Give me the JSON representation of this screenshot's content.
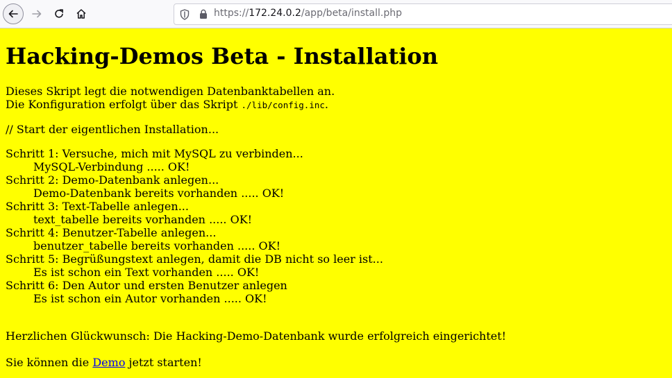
{
  "browser": {
    "url_prefix": "https://",
    "url_host": "172.24.0.2",
    "url_path": "/app/beta/install.php"
  },
  "page": {
    "title": "Hacking-Demos Beta - Installation",
    "intro_line1": "Dieses Skript legt die notwendigen Datenbanktabellen an.",
    "intro_line2_prefix": "Die Konfiguration erfolgt über das Skript ",
    "config_path": "./lib/config.inc",
    "intro_line2_suffix": ".",
    "start_comment": "// Start der eigentlichen Installation...",
    "steps": [
      {
        "label": "Schritt 1: Versuche, mich mit MySQL zu verbinden...",
        "result": "MySQL-Verbindung ..... OK!"
      },
      {
        "label": "Schritt 2: Demo-Datenbank anlegen...",
        "result": "Demo-Datenbank bereits vorhanden ..... OK!"
      },
      {
        "label": "Schritt 3: Text-Tabelle anlegen...",
        "result": "text_tabelle bereits vorhanden ..... OK!"
      },
      {
        "label": "Schritt 4: Benutzer-Tabelle anlegen...",
        "result": "benutzer_tabelle bereits vorhanden ..... OK!"
      },
      {
        "label": "Schritt 5: Begrüßungstext anlegen, damit die DB nicht so leer ist...",
        "result": "Es ist schon ein Text vorhanden ..... OK!"
      },
      {
        "label": "Schritt 6: Den Autor und ersten Benutzer anlegen",
        "result": "Es ist schon ein Autor vorhanden ..... OK!"
      }
    ],
    "congrats": "Herzlichen Glückwunsch: Die Hacking-Demo-Datenbank wurde erfolgreich eingerichtet!",
    "start_prefix": "Sie können die ",
    "demo_link": "Demo",
    "start_suffix": " jetzt starten!"
  },
  "colors": {
    "page_background": "#ffff00",
    "link": "#0000ee"
  },
  "icons": {
    "back": "arrow-left-icon",
    "forward": "arrow-right-icon",
    "reload": "reload-icon",
    "home": "home-icon",
    "tracking": "shield-icon",
    "secure": "lock-icon"
  }
}
